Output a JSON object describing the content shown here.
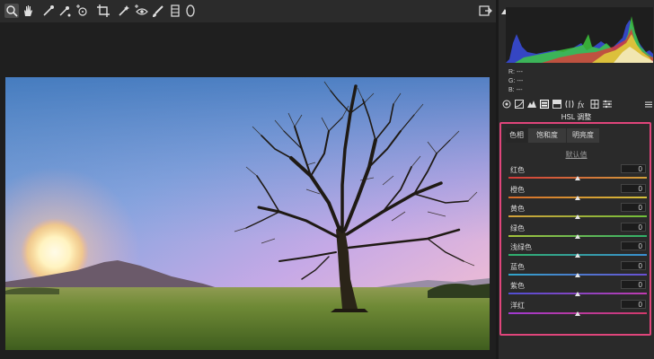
{
  "toolbar": {
    "tools": [
      "zoom-icon",
      "hand-icon",
      "eyedropper-icon",
      "color-sampler-icon",
      "target-adjust-icon",
      "crop-icon",
      "spot-removal-icon",
      "red-eye-icon",
      "brush-icon",
      "graduated-filter-icon",
      "radial-filter-icon"
    ]
  },
  "histogram": {
    "r_label": "R:",
    "r_value": "---",
    "g_label": "G:",
    "g_value": "---",
    "b_label": "B:",
    "b_value": "---"
  },
  "panel": {
    "title": "HSL 调整",
    "tabs": [
      {
        "label": "色相"
      },
      {
        "label": "饱和度"
      },
      {
        "label": "明亮度"
      }
    ],
    "default_link": "默认值",
    "sliders": [
      {
        "label": "红色",
        "value": "0",
        "color_left": "#d33a3a",
        "color_right": "#d3a03a"
      },
      {
        "label": "橙色",
        "value": "0",
        "color_left": "#d86a2a",
        "color_right": "#d3c03a"
      },
      {
        "label": "黄色",
        "value": "0",
        "color_left": "#d3a03a",
        "color_right": "#6fbf3a"
      },
      {
        "label": "绿色",
        "value": "0",
        "color_left": "#a6c23a",
        "color_right": "#2fb06a"
      },
      {
        "label": "浅绿色",
        "value": "0",
        "color_left": "#2fb06a",
        "color_right": "#3a8fd3"
      },
      {
        "label": "蓝色",
        "value": "0",
        "color_left": "#2fa6c9",
        "color_right": "#6a4fd3"
      },
      {
        "label": "紫色",
        "value": "0",
        "color_left": "#4f4fd3",
        "color_right": "#c03ab0"
      },
      {
        "label": "洋红",
        "value": "0",
        "color_left": "#a03ad3",
        "color_right": "#d33a6a"
      }
    ]
  }
}
